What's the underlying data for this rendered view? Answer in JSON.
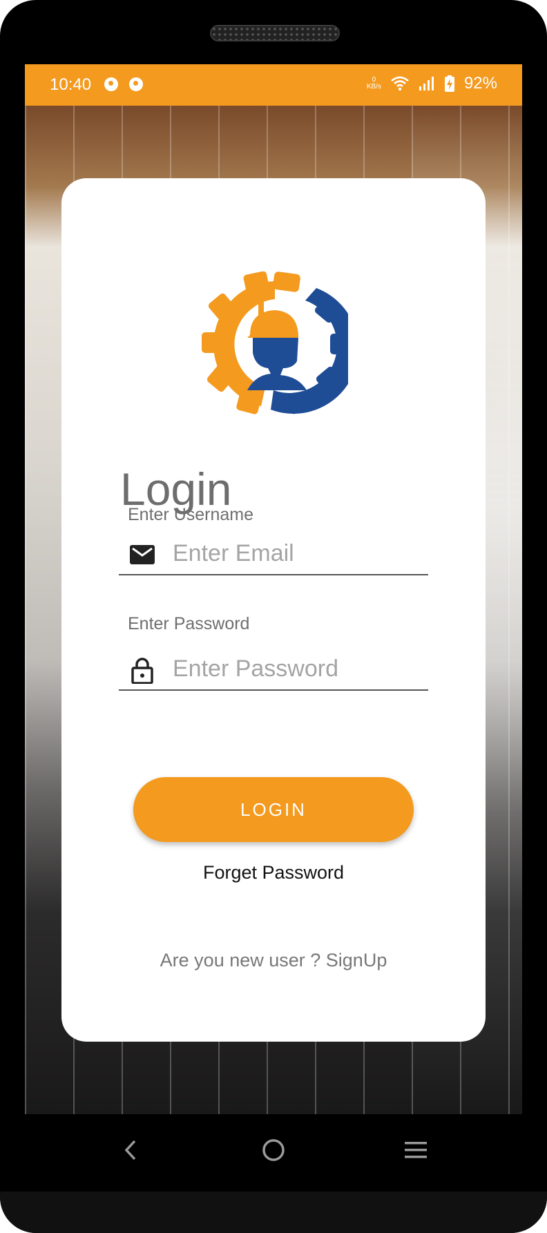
{
  "status_bar": {
    "time": "10:40",
    "net_speed_value": "0",
    "net_speed_unit": "KB/s",
    "battery": "92%",
    "icons": [
      "app-notification-icon",
      "app-notification-icon",
      "wifi-icon",
      "signal-icon",
      "battery-charging-icon"
    ]
  },
  "login": {
    "title": "Login",
    "username_label": "Enter Username",
    "email_placeholder": "Enter Email",
    "password_label": "Enter Password",
    "password_placeholder": "Enter Password",
    "login_button": "LOGIN",
    "forget_password": "Forget Password",
    "signup_text": "Are you new user ? SignUp"
  },
  "colors": {
    "accent": "#f39a1f",
    "logo_blue": "#1e4d95"
  },
  "nav": {
    "icons": [
      "back-icon",
      "home-icon",
      "recents-icon"
    ]
  }
}
